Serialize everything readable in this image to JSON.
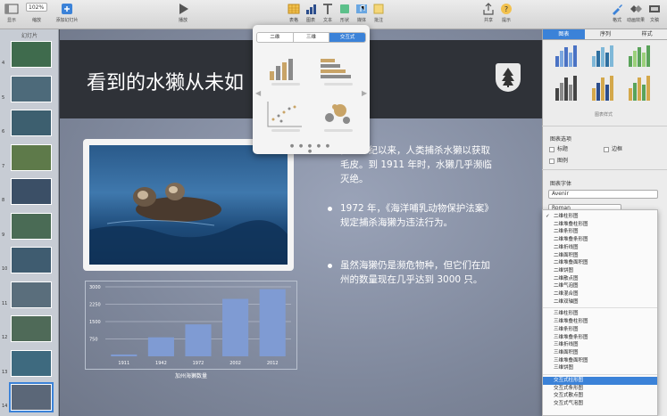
{
  "toolbar": {
    "view_label": "显示",
    "zoom_value": "102%",
    "zoom_label": "缩放",
    "add_slide_label": "添加幻灯片",
    "play_label": "播放",
    "table_label": "表格",
    "chart_label": "图表",
    "text_label": "文本",
    "shape_label": "形状",
    "media_label": "媒体",
    "comment_label": "批注",
    "share_label": "共享",
    "tips_label": "提示",
    "format_label": "格式",
    "animate_label": "动画效果",
    "document_label": "文稿"
  },
  "navigator": {
    "header": "幻灯片",
    "slide_numbers": [
      "4",
      "5",
      "6",
      "7",
      "8",
      "9",
      "10",
      "11",
      "12",
      "13",
      "14"
    ],
    "selected": "14"
  },
  "slide": {
    "title": "看到的水獭从未如",
    "bullets": [
      "多个世纪以来，人类捕杀水獭以获取毛皮。到 1911 年时，水獭几乎濒临灭绝。",
      "1972 年，《海洋哺乳动物保护法案》 规定捕杀海獭为违法行为。",
      "虽然海獭仍是濒危物种，但它们在加州的数量现在几乎达到 3000 只。"
    ]
  },
  "chart_data": {
    "type": "bar",
    "title": "",
    "categories": [
      "1911",
      "1942",
      "1972",
      "2002",
      "2012"
    ],
    "values": [
      80,
      820,
      1380,
      2480,
      2900
    ],
    "xlabel": "加州海獭数量",
    "ylabel": "",
    "ylim": [
      0,
      3000
    ],
    "yticks": [
      "3000",
      "2250",
      "1500",
      "750"
    ],
    "color": "#7f9bd3",
    "grid": true
  },
  "popover": {
    "tabs": [
      "二维",
      "三维",
      "交互式"
    ],
    "active_tab": "交互式"
  },
  "inspector": {
    "tabs": [
      "图表",
      "序列",
      "样式"
    ],
    "active_tab": "图表",
    "chart_styles_label": "图表样式",
    "chart_options_label": "图表选项",
    "title_option": "标题",
    "border_option": "边框",
    "legend_option": "图例",
    "chart_font_label": "图表字体",
    "font_name": "Avenir",
    "font_style": "Roman"
  },
  "menu": {
    "group1": [
      "二维柱形图",
      "二维堆叠柱形图",
      "二维条形图",
      "二维堆叠条形图",
      "二维折线图",
      "二维面积图",
      "二维堆叠面积图",
      "二维饼图",
      "二维散点图",
      "二维气泡图",
      "二维混合图",
      "二维双轴图"
    ],
    "group2": [
      "三维柱形图",
      "三维堆叠柱形图",
      "三维条形图",
      "三维堆叠条形图",
      "三维折线图",
      "三维面积图",
      "三维堆叠面积图",
      "三维饼图"
    ],
    "group3": [
      "交互式柱形图",
      "交互式条形图",
      "交互式散点图",
      "交互式气泡图"
    ],
    "checked": "二维柱形图",
    "highlighted": "交互式柱形图"
  },
  "colors": {
    "accent": "#3b82d8",
    "bar": "#7f9bd3"
  }
}
